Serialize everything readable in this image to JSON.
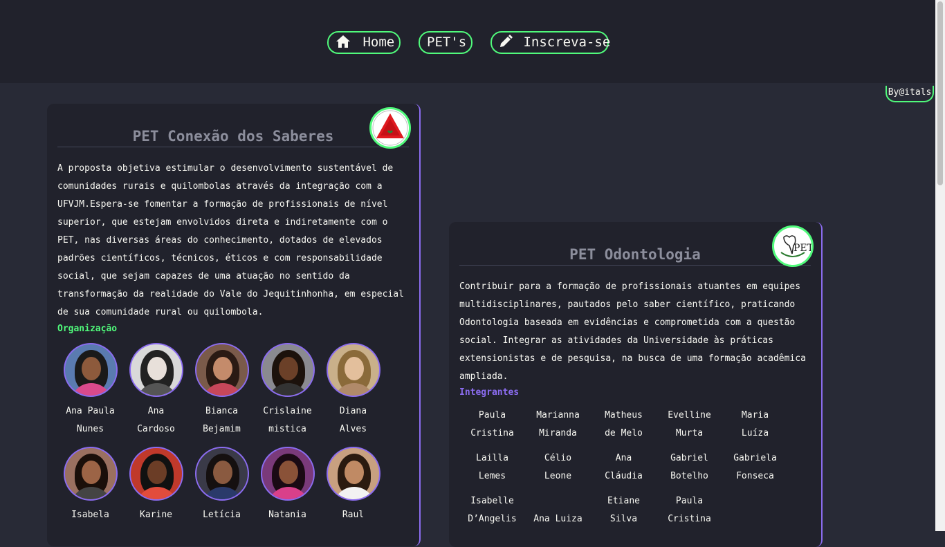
{
  "nav": {
    "home_label": "Home",
    "pets_label": "PET's",
    "signup_label": "Inscreva-se"
  },
  "credit": "By@itals",
  "cards": [
    {
      "title": "PET Conexão dos Saberes",
      "description": "A proposta objetiva estimular o desenvolvimento sustentável de comunidades rurais e quilombolas através da integração com a UFVJM.Espera-se fomentar a formação de profissionais de nível superior, que estejam envolvidos direta e indiretamente com o PET, nas diversas áreas do conhecimento, dotados de elevados padrões científicos, técnicos, éticos e com responsabilidade social, que sejam capazes de uma atuação no sentido da transformação da realidade do Vale do Jequitinhonha, em especial de sua comunidade rural ou quilombola.",
      "section_label": "Organização",
      "section_color": "#50fa7b",
      "members": [
        [
          "Ana Paula",
          "Nunes"
        ],
        [
          "Ana",
          "Cardoso"
        ],
        [
          "Bianca",
          "Bejamim"
        ],
        [
          "Crislaine",
          "mistica"
        ],
        [
          "Diana",
          "Alves"
        ],
        [
          "Isabela",
          ""
        ],
        [
          "Karine",
          ""
        ],
        [
          "Letícia",
          ""
        ],
        [
          "Natania",
          ""
        ],
        [
          "Raul",
          ""
        ]
      ]
    },
    {
      "title": "PET Odontologia",
      "logo_text": "PET",
      "description": "Contribuir para a formação de profissionais atuantes em equipes multidisciplinares, pautados pelo saber científico, praticando Odontologia baseada em evidências e comprometida com a questão social. Integrar as atividades da Universidade às práticas extensionistas e de pesquisa, na busca de uma formação acadêmica ampliada.",
      "section_label": "Integrantes",
      "section_color": "#8b6cf0",
      "members": [
        [
          "Paula",
          "Cristina"
        ],
        [
          "Marianna",
          "Miranda"
        ],
        [
          "Matheus",
          "de Melo"
        ],
        [
          "Evelline",
          "Murta"
        ],
        [
          "Maria",
          "Luíza"
        ],
        [
          "Lailla",
          "Lemes"
        ],
        [
          "Célio",
          "Leone"
        ],
        [
          "Ana",
          "Cláudia"
        ],
        [
          "Gabriel",
          "Botelho"
        ],
        [
          "Gabriela",
          "Fonseca"
        ],
        [
          "Isabelle",
          "D’Angelis"
        ],
        [
          "",
          "Ana Luiza"
        ],
        [
          "Etiane",
          "Silva"
        ],
        [
          "Paula",
          "Cristina"
        ]
      ]
    }
  ],
  "icons": {
    "home": "home-icon",
    "pencil": "pencil-icon"
  }
}
